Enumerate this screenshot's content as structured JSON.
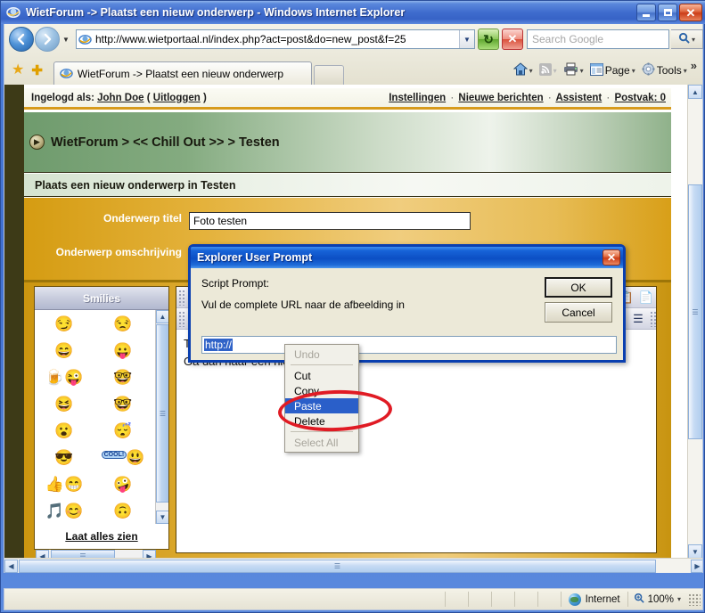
{
  "window": {
    "title": "WietForum -> Plaatst een nieuw onderwerp - Windows Internet Explorer",
    "icon": "ie-icon",
    "minimize_label": "Minimize",
    "maximize_label": "Maximize",
    "close_label": "Close"
  },
  "toolbar": {
    "back_label": "←",
    "forward_label": "→",
    "history_caret": "▼",
    "address_value": "http://www.wietportaal.nl/index.php?act=post&do=new_post&f=25",
    "address_caret": "▼",
    "go_label": "↻",
    "stop_label": "✕",
    "search_placeholder": "Search Google",
    "search_value": "",
    "search_go_icon": "search-icon",
    "search_go_caret": "▾"
  },
  "tabs": {
    "favorites_icon": "star-icon",
    "add_favorite_icon": "plus-icon",
    "items": [
      {
        "label": "WietForum -> Plaatst een nieuw onderwerp",
        "icon": "ie-icon",
        "active": true
      }
    ],
    "new_tab_label": ""
  },
  "commandbar": {
    "home_icon": "home-icon",
    "feeds_icon": "rss-icon",
    "print_icon": "printer-icon",
    "page_label": "Page",
    "tools_label": "Tools",
    "overflow_label": "»",
    "caret": "▾"
  },
  "forum": {
    "login_prefix": "Ingelogd als:",
    "username": "John Doe",
    "logout_open": "(",
    "logout_label": "Uitloggen",
    "logout_close": ")",
    "nav_links": [
      "Instellingen",
      "Nieuwe berichten",
      "Assistent",
      "Postvak: 0"
    ],
    "nav_separator": "·",
    "breadcrumb_icon": "play-circle-icon",
    "breadcrumb": "WietForum > << Chill Out >> > Testen",
    "subtitle": "Plaats een nieuw onderwerp in Testen",
    "fields": [
      {
        "label": "Onderwerp titel",
        "value": "Foto testen"
      },
      {
        "label": "Onderwerp omschrijving",
        "value": ""
      }
    ],
    "smilies": {
      "header": "Smilies",
      "footer_link": "Laat alles zien",
      "rows": [
        [
          {
            "glyph": "😏",
            "name": "smirk"
          },
          {
            "glyph": "😒",
            "name": "unamused"
          }
        ],
        [
          {
            "glyph": "😄",
            "name": "grin"
          },
          {
            "glyph": "😛",
            "name": "tongue"
          }
        ],
        [
          {
            "glyph": "🍺😜",
            "name": "beer-drink"
          },
          {
            "glyph": "🤓",
            "name": "monocle"
          }
        ],
        [
          {
            "glyph": "😆",
            "name": "laugh"
          },
          {
            "glyph": "🤓",
            "name": "nerd-glasses"
          }
        ],
        [
          {
            "glyph": "😮",
            "name": "surprised"
          },
          {
            "glyph": "😴",
            "name": "sleepy"
          }
        ],
        [
          {
            "glyph": "😎",
            "name": "smoking-cool"
          },
          {
            "glyph": "😃",
            "name": "cool-bubble"
          }
        ],
        [
          {
            "glyph": "👍😁",
            "name": "thumbs-up"
          },
          {
            "glyph": "🤪",
            "name": "goofy"
          }
        ],
        [
          {
            "glyph": "🎵😊",
            "name": "music-note"
          },
          {
            "glyph": "🙃",
            "name": "wink"
          }
        ]
      ],
      "cool_bubble_text": "COOL!"
    },
    "editor": {
      "toolbar_icons": [
        "cut-icon",
        "copy-icon",
        "paste-icon",
        "align-left-icon",
        "align-center-icon"
      ],
      "text_lines": [
        "Ty",
        "Ga dan naar een nie"
      ]
    }
  },
  "dialog": {
    "title": "Explorer User Prompt",
    "close_label": "✕",
    "prompt_label": "Script Prompt:",
    "prompt_message": "Vul de complete URL naar de afbeelding in",
    "input_value": "http://",
    "ok_label": "OK",
    "cancel_label": "Cancel"
  },
  "context_menu": {
    "items": [
      {
        "label": "Undo",
        "state": "disabled"
      },
      {
        "label": "Cut",
        "state": "normal"
      },
      {
        "label": "Copy",
        "state": "normal"
      },
      {
        "label": "Paste",
        "state": "highlighted"
      },
      {
        "label": "Delete",
        "state": "normal"
      },
      {
        "label": "Select All",
        "state": "disabled"
      }
    ]
  },
  "annotation": {
    "shape": "red-ellipse",
    "color": "#e01b24",
    "target": "Paste"
  },
  "statusbar": {
    "zone_icon": "globe-icon",
    "zone_label": "Internet",
    "zoom_icon": "zoom-icon",
    "zoom_label": "100%",
    "zoom_caret": "▾"
  }
}
